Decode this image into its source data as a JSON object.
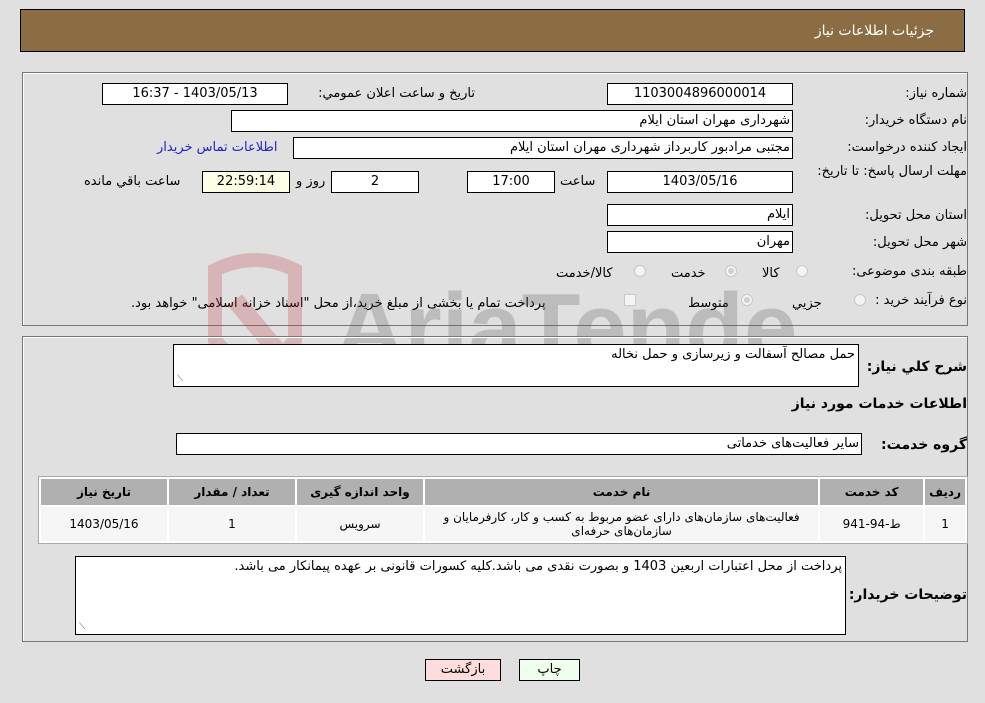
{
  "header": {
    "title": "جزئیات اطلاعات نیاز"
  },
  "info": {
    "need_number_label": "شماره نیاز:",
    "need_number": "1103004896000014",
    "announce_label": "تاریخ و ساعت اعلان عمومي:",
    "announce_value": "1403/05/13 - 16:37",
    "buyer_org_label": "نام دستگاه خريدار:",
    "buyer_org": "شهرداری مهران استان ایلام",
    "creator_label": "ایجاد کننده درخواست:",
    "creator": "مجتبی مرادبور کاربرداز شهرداری مهران استان ایلام",
    "contact_link": "اطلاعات تماس خریدار",
    "deadline_label": "مهلت ارسال پاسخ: تا تاریخ:",
    "deadline_date": "1403/05/16",
    "time_label": "ساعت",
    "deadline_time": "17:00",
    "days_value": "2",
    "days_label": "روز و",
    "remaining_time": "22:59:14",
    "remaining_label": "ساعت باقي مانده",
    "province_label": "استان محل تحویل:",
    "province": "ایلام",
    "city_label": "شهر محل تحویل:",
    "city": "مهران",
    "category_label": "طبقه بندی موضوعی:",
    "category_options": [
      {
        "label": "کالا",
        "checked": false
      },
      {
        "label": "خدمت",
        "checked": true
      },
      {
        "label": "کالا/خدمت",
        "checked": false
      }
    ],
    "process_label": "نوع فرآیند خرید :",
    "process_options": [
      {
        "label": "جزيي",
        "checked": false
      },
      {
        "label": "متوسط",
        "checked": true
      }
    ],
    "treasury_note": "پرداخت تمام یا بخشی از مبلغ خرید،از محل \"اسناد خزانه اسلامی\" خواهد بود."
  },
  "details": {
    "description_label": "شرح کلي نياز:",
    "description": "حمل مصالح آسفالت و زیرسازی و حمل نخاله",
    "services_heading": "اطلاعات خدمات مورد نياز",
    "service_group_label": "گروه خدمت:",
    "service_group": "سایر فعالیت‌های خدماتی",
    "table": {
      "headers": [
        "ردیف",
        "کد خدمت",
        "نام خدمت",
        "واحد اندازه گیری",
        "تعداد / مقدار",
        "تاریخ نیاز"
      ],
      "rows": [
        [
          "1",
          "ط-94-941",
          "فعالیت‌های سازمان‌های دارای عضو مربوط به کسب و کار، کارفرمایان و سازمان‌های حرفه‌ای",
          "سرویس",
          "1",
          "1403/05/16"
        ]
      ]
    },
    "buyer_notes_label": "توضيحات خريدار:",
    "buyer_notes": "پرداخت از محل اعتبارات اربعین 1403 و بصورت نقدی می باشد.کلیه کسورات قانونی بر عهده پیمانکار می باشد."
  },
  "buttons": {
    "print": "چاپ",
    "back": "بازگشت"
  },
  "watermark": {
    "text": "AriaTender.neT"
  }
}
